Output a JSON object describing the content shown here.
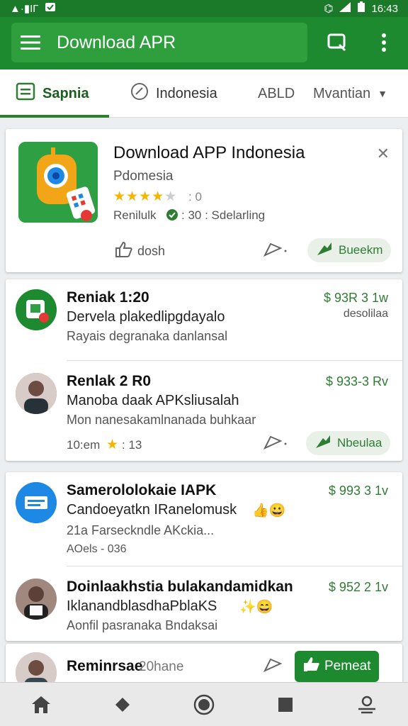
{
  "status": {
    "left": "▲·▮ΙΓ",
    "time": "16:43"
  },
  "appbar": {
    "title": "Download APR"
  },
  "tabs": [
    {
      "label": "Sapnia"
    },
    {
      "label": "Indonesia"
    },
    {
      "label": "ABLD"
    },
    {
      "label": "Mvantian"
    }
  ],
  "featured": {
    "title": "Download APP Indonesia",
    "subtitle": "Pdomesia",
    "rating_text": ": 0",
    "meta": "Renilulk",
    "meta2": ": 30 : Sdelarling",
    "like_label": "dosh",
    "action_label": "Bueekm"
  },
  "group1": [
    {
      "name": "Reniak 1:20",
      "line1": "Dervela plakedlipgdayalo",
      "line2": "Rayais degranaka danlansal",
      "price": "$ 93R 3 1w",
      "price_sub": "desolilaa"
    },
    {
      "name": "Renlak 2 R0",
      "line1": "Manoba daak APKsliusalah",
      "line2": "Mon nanesakamlnanada buhkaar",
      "price": "$ 933-3 Rv",
      "meta": "10:em",
      "meta2": ": 13",
      "action_label": "Nbeulaa"
    }
  ],
  "group2": [
    {
      "name": "Samerololokaie IAPK",
      "line1": "Candoeyatkn IRanelomusk",
      "line2": "21a Farseckndle AKckia...",
      "line3": "AOels - 036",
      "price": "$ 993 3 1v"
    },
    {
      "name": "Doinlaakhstia bulakandamidkan",
      "line1": "IklanandblasdhaPblaKS",
      "line2": "Aonfil pasranaka Bndaksai",
      "price": "$ 952 2 1v"
    }
  ],
  "bottom_row": {
    "name": "Reminrsae",
    "meta": "20hane",
    "action_label": "Pemeat"
  },
  "colors": {
    "primary": "#1e8a30",
    "accent": "#2e7d32",
    "star": "#f5b400"
  }
}
